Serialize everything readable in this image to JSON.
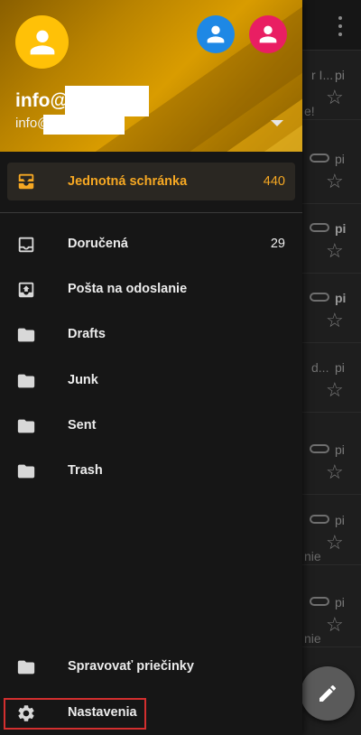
{
  "background": {
    "rows": [
      {
        "fragment": "r I...",
        "pi": "pi",
        "pi_bold": false,
        "clip": false,
        "sub": "e!"
      },
      {
        "fragment": "",
        "pi": "pi",
        "pi_bold": false,
        "clip": true,
        "sub": ""
      },
      {
        "fragment": "",
        "pi": "pi",
        "pi_bold": true,
        "clip": true,
        "sub": ""
      },
      {
        "fragment": "",
        "pi": "pi",
        "pi_bold": true,
        "clip": true,
        "sub": ""
      },
      {
        "fragment": "d...",
        "pi": "pi",
        "pi_bold": false,
        "clip": false,
        "sub": ""
      },
      {
        "fragment": "",
        "pi": "pi",
        "pi_bold": false,
        "clip": true,
        "sub": ""
      },
      {
        "fragment": "",
        "pi": "pi",
        "pi_bold": false,
        "clip": true,
        "sub": "nie"
      },
      {
        "fragment": "",
        "pi": "pi",
        "pi_bold": false,
        "clip": true,
        "sub": "nie"
      }
    ]
  },
  "account": {
    "name": "info@",
    "email": "info@"
  },
  "unified_inbox": {
    "label": "Jednotná schránka",
    "count": "440"
  },
  "folders": [
    {
      "label": "Doručená",
      "count": "29",
      "icon": "inbox-icon"
    },
    {
      "label": "Pošta na odoslanie",
      "count": "",
      "icon": "outbox-icon"
    },
    {
      "label": "Drafts",
      "count": "",
      "icon": "folder-icon"
    },
    {
      "label": "Junk",
      "count": "",
      "icon": "folder-icon"
    },
    {
      "label": "Sent",
      "count": "",
      "icon": "folder-icon"
    },
    {
      "label": "Trash",
      "count": "",
      "icon": "folder-icon"
    }
  ],
  "footer": {
    "manage_folders": "Spravovať priečinky",
    "settings": "Nastavenia"
  },
  "colors": {
    "accent": "#f6a823",
    "header_base": "#d99c00",
    "avatar_main": "#ffc107",
    "avatar_blue": "#1e88e5",
    "avatar_pink": "#e91e63",
    "highlight": "#d32f2f"
  }
}
